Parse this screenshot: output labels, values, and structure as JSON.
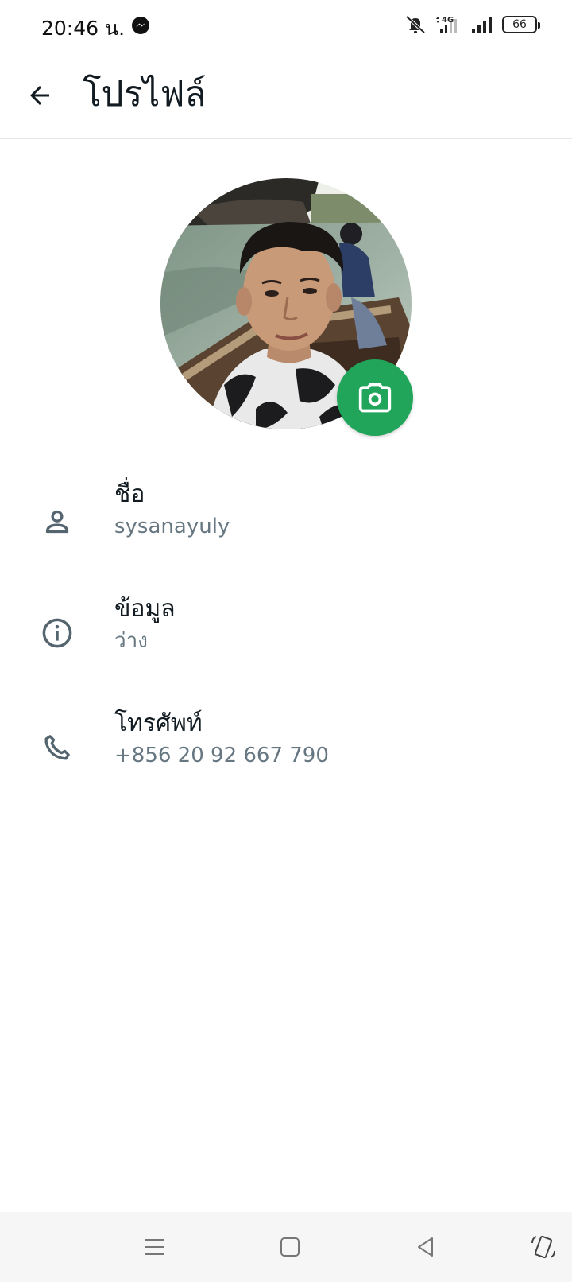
{
  "status_bar": {
    "time": "20:46 น.",
    "network": "4G",
    "battery": "66"
  },
  "app_bar": {
    "title": "โปรไฟล์"
  },
  "profile": {
    "rows": [
      {
        "icon": "person-icon",
        "label": "ชื่อ",
        "value": "sysanayuly"
      },
      {
        "icon": "info-icon",
        "label": "ข้อมูล",
        "value": "ว่าง"
      },
      {
        "icon": "phone-icon",
        "label": "โทรศัพท์",
        "value": "+856 20 92 667 790"
      }
    ]
  },
  "colors": {
    "accent": "#21a55a",
    "secondary_text": "#667781",
    "icon": "#54656f"
  }
}
